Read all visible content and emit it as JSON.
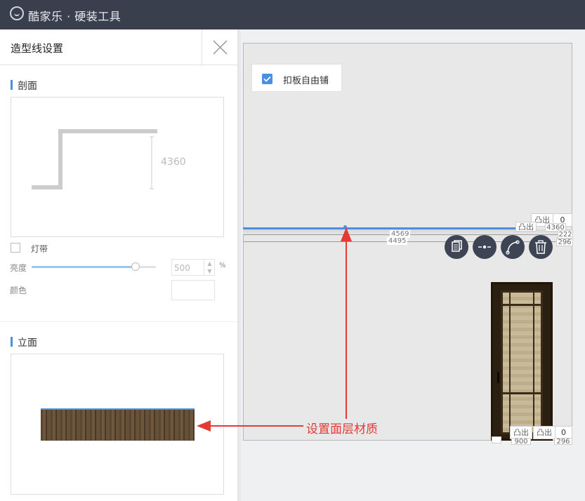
{
  "app": {
    "title": "酷家乐 · 硬装工具"
  },
  "panel": {
    "title": "造型线设置",
    "section_profile": "剖面",
    "profile_dimension": "4360",
    "light_strip_label": "灯带",
    "brightness_label": "亮度",
    "brightness_value": "500",
    "brightness_unit": "%",
    "brightness_level": 0.83,
    "color_label": "颜色",
    "section_elevation": "立面"
  },
  "canvas": {
    "option_label": "扣板自由铺",
    "option_checked": true,
    "dim_4569": "4569",
    "dim_4495": "4495",
    "top_tag_label": "凸出",
    "top_tag_value": "0",
    "top_tag2_label": "凸出",
    "dim_4360": "4360",
    "dim_222": "222",
    "dim_296_top": "296",
    "bottom_tag1_label": "凸出",
    "bottom_tag2_label": "凸出",
    "bottom_tag_value": "0",
    "dim_900": "900",
    "dim_296_bottom": "296",
    "toolbar": [
      "copy-icon",
      "split-icon",
      "curve-icon",
      "delete-icon"
    ]
  },
  "annotation": {
    "text": "设置面层材质",
    "color": "#e53935"
  },
  "colors": {
    "topbar": "#393f4d",
    "accent": "#4a90e2",
    "toolbar_button": "#3d4555"
  }
}
